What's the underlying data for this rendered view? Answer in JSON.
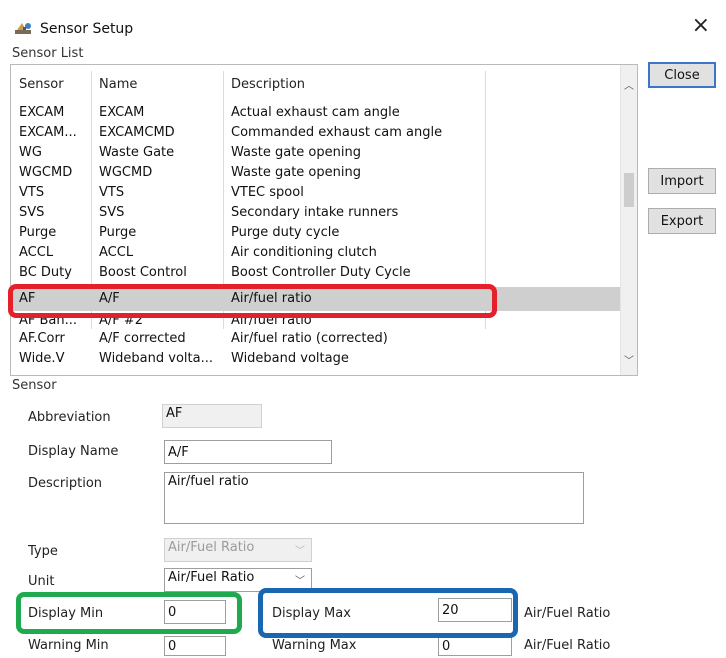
{
  "window": {
    "title": "Sensor Setup",
    "close_glyph": "×"
  },
  "sensor_list": {
    "group_label": "Sensor List",
    "columns": [
      "Sensor",
      "Name",
      "Description"
    ],
    "rows": [
      {
        "sensor": "EXCAM",
        "name": "EXCAM",
        "description": "Actual exhaust cam angle"
      },
      {
        "sensor": "EXCAM...",
        "name": "EXCAMCMD",
        "description": "Commanded exhaust cam angle"
      },
      {
        "sensor": "WG",
        "name": "Waste Gate",
        "description": "Waste gate opening"
      },
      {
        "sensor": "WGCMD",
        "name": "WGCMD",
        "description": "Waste gate opening"
      },
      {
        "sensor": "VTS",
        "name": "VTS",
        "description": "VTEC spool"
      },
      {
        "sensor": "SVS",
        "name": "SVS",
        "description": "Secondary intake runners"
      },
      {
        "sensor": "Purge",
        "name": "Purge",
        "description": "Purge duty cycle"
      },
      {
        "sensor": "ACCL",
        "name": "ACCL",
        "description": "Air conditioning clutch"
      },
      {
        "sensor": "BC Duty",
        "name": "Boost Control",
        "description": "Boost Controller Duty Cycle"
      },
      {
        "sensor": "AF",
        "name": "A/F",
        "description": "Air/fuel ratio",
        "selected": true
      },
      {
        "sensor": "AF Ban...",
        "name": "A/F #2",
        "description": "Air/fuel ratio"
      },
      {
        "sensor": "AF.Corr",
        "name": "A/F corrected",
        "description": "Air/fuel ratio (corrected)"
      },
      {
        "sensor": "Wide.V",
        "name": "Wideband volta...",
        "description": "Wideband voltage"
      }
    ]
  },
  "buttons": {
    "close": "Close",
    "import": "Import",
    "export": "Export"
  },
  "sensor": {
    "group_label": "Sensor",
    "abbreviation_label": "Abbreviation",
    "abbreviation_value": "AF",
    "display_name_label": "Display Name",
    "display_name_value": "A/F",
    "description_label": "Description",
    "description_value": "Air/fuel ratio",
    "type_label": "Type",
    "type_value": "Air/Fuel Ratio",
    "unit_label": "Unit",
    "unit_value": "Air/Fuel Ratio",
    "display_min_label": "Display Min",
    "display_min_value": "0",
    "display_max_label": "Display Max",
    "display_max_value": "20",
    "display_max_unit": "Air/Fuel Ratio",
    "warning_min_label": "Warning Min",
    "warning_min_value": "0",
    "warning_max_label": "Warning Max",
    "warning_max_value": "0",
    "warning_max_unit": "Air/Fuel Ratio"
  },
  "highlight_colors": {
    "red": "#e4202a",
    "green": "#1faa4f",
    "blue": "#1967b1"
  }
}
